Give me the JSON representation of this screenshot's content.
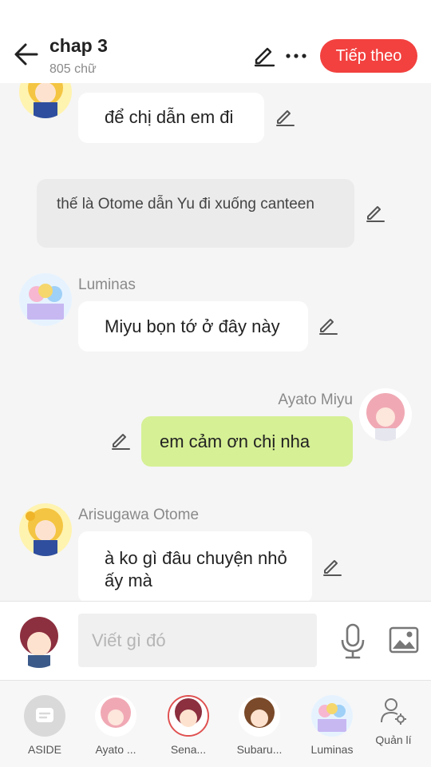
{
  "header": {
    "title": "chap 3",
    "word_count": "805 chữ",
    "next_label": "Tiếp theo",
    "next_color": "#f2413f"
  },
  "messages": [
    {
      "type": "left",
      "sender": "",
      "text": "để chị dẫn em đi",
      "avatar": "otome-avatar"
    },
    {
      "type": "narration",
      "text": "thế là Otome dẫn Yu đi xuống canteen"
    },
    {
      "type": "left",
      "sender": "Luminas",
      "text": "Miyu bọn tớ ở đây này",
      "avatar": "luminas-avatar"
    },
    {
      "type": "right",
      "sender": "Ayato  Miyu",
      "text": "em cảm ơn chị nha",
      "avatar": "miyu-avatar"
    },
    {
      "type": "left",
      "sender": "Arisugawa Otome",
      "text": "à ko gì đâu chuyện nhỏ ấy mà",
      "avatar": "otome-avatar"
    }
  ],
  "composer": {
    "placeholder": "Viết gì đó",
    "mic_icon": "microphone-icon",
    "image_icon": "image-icon"
  },
  "cast": [
    {
      "label": "ASIDE",
      "icon": "aside-icon"
    },
    {
      "label": "Ayato ...",
      "icon": "miyu-avatar"
    },
    {
      "label": "Sena...",
      "icon": "sena-avatar"
    },
    {
      "label": "Subaru...",
      "icon": "subaru-avatar"
    },
    {
      "label": "Luminas",
      "icon": "luminas-avatar"
    },
    {
      "label": "Quản lí",
      "icon": "manage-characters-icon"
    }
  ]
}
